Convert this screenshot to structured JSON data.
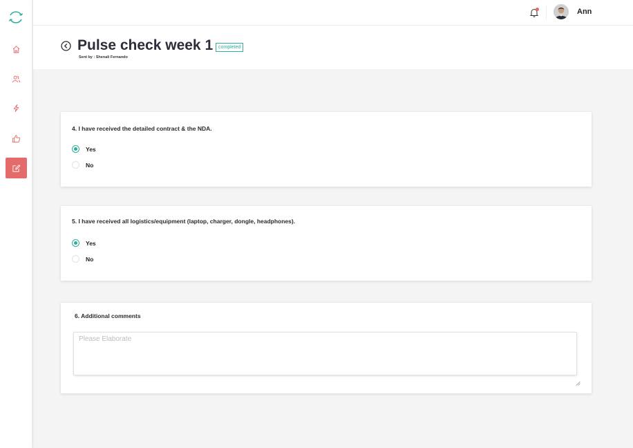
{
  "app": {
    "logo_icon": "circular-arrows-logo",
    "brand_color": "#2fae9a",
    "accent_color": "#e56a6a"
  },
  "sidebar": {
    "items": [
      {
        "name": "home",
        "icon": "home-icon",
        "active": false
      },
      {
        "name": "people",
        "icon": "people-icon",
        "active": false
      },
      {
        "name": "flash",
        "icon": "lightning-icon",
        "active": false
      },
      {
        "name": "kudos",
        "icon": "thumbs-up-icon",
        "active": false
      },
      {
        "name": "surveys",
        "icon": "edit-icon",
        "active": true
      }
    ]
  },
  "topbar": {
    "notification_icon": "bell-icon",
    "has_unread": true,
    "user_name": "Ann"
  },
  "header": {
    "title": "Pulse check week 1",
    "status": "completed",
    "sent_by": "Sent by : Shenali Fernando"
  },
  "questions": [
    {
      "text": "4. I have received the detailed contract & the NDA.",
      "options": [
        {
          "label": "Yes",
          "selected": true
        },
        {
          "label": "No",
          "selected": false
        }
      ]
    },
    {
      "text": "5. I have received all logistics/equipment (laptop, charger, dongle, headphones).",
      "options": [
        {
          "label": "Yes",
          "selected": true
        },
        {
          "label": "No",
          "selected": false
        }
      ]
    }
  ],
  "comments": {
    "label": "6. Additional comments",
    "placeholder": "Please Elaborate",
    "value": ""
  }
}
